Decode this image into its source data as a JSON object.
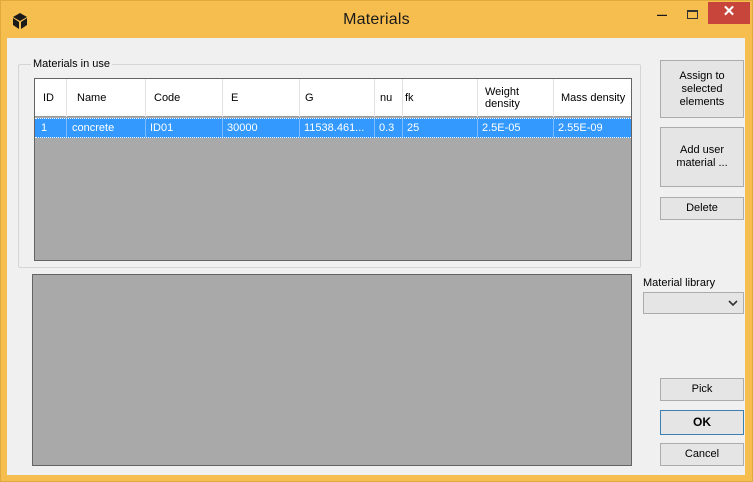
{
  "window": {
    "title": "Materials",
    "close_glyph": "✕",
    "minimize_glyph": "–"
  },
  "materials_group": {
    "legend": "Materials in use",
    "columns": [
      "ID",
      "Name",
      "Code",
      "E",
      "G",
      "nu",
      "fk",
      "Weight density",
      "Mass density"
    ],
    "rows": [
      {
        "id": "1",
        "name": "concrete",
        "code": "ID01",
        "e": "30000",
        "g": "11538.461...",
        "nu": "0.3",
        "fk": "25",
        "weight_density": "2.5E-05",
        "mass_density": "2.55E-09",
        "selected": true
      }
    ]
  },
  "buttons": {
    "assign": "Assign to selected elements",
    "add_user": "Add user material ...",
    "delete": "Delete",
    "pick": "Pick",
    "ok": "OK",
    "cancel": "Cancel"
  },
  "library": {
    "label": "Material library",
    "selected_value": "",
    "icon": "chevron-down-icon"
  },
  "colors": {
    "title_bar": "#f6be4f",
    "close_button": "#c7453a",
    "selection": "#3399ff",
    "grid_background": "#a9a9a9"
  }
}
